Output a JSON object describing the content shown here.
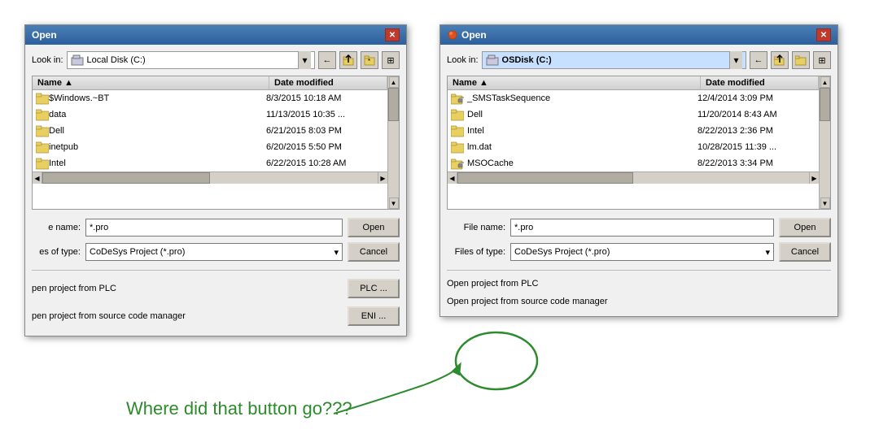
{
  "left_dialog": {
    "title": "Open",
    "look_in_label": "Look in:",
    "look_in_value": "Local Disk (C:)",
    "columns": [
      "Name",
      "Date modified"
    ],
    "files": [
      {
        "name": "$Windows.~BT",
        "date": "8/3/2015 10:18 AM",
        "type": "folder"
      },
      {
        "name": "data",
        "date": "11/13/2015 10:35 ...",
        "type": "folder"
      },
      {
        "name": "Dell",
        "date": "6/21/2015 8:03 PM",
        "type": "folder"
      },
      {
        "name": "inetpub",
        "date": "6/20/2015 5:50 PM",
        "type": "folder"
      },
      {
        "name": "Intel",
        "date": "6/22/2015 10:28 AM",
        "type": "folder"
      }
    ],
    "file_name_label": "e name:",
    "file_name_value": "*.pro",
    "file_type_label": "es of type:",
    "file_type_value": "CoDeSys Project (*.pro)",
    "open_btn": "Open",
    "cancel_btn": "Cancel",
    "plc_label": "pen project from PLC",
    "plc_btn": "PLC ...",
    "eni_label": "pen project from source code manager",
    "eni_btn": "ENI ..."
  },
  "right_dialog": {
    "title": "Open",
    "look_in_label": "Look in:",
    "look_in_value": "OSDisk (C:)",
    "columns": [
      "Name",
      "Date modified"
    ],
    "files": [
      {
        "name": "_SMSTaskSequence",
        "date": "12/4/2014 3:09 PM",
        "type": "folder-lock"
      },
      {
        "name": "Dell",
        "date": "11/20/2014 8:43 AM",
        "type": "folder"
      },
      {
        "name": "Intel",
        "date": "8/22/2013 2:36 PM",
        "type": "folder"
      },
      {
        "name": "lm.dat",
        "date": "10/28/2015 11:39 ...",
        "type": "folder"
      },
      {
        "name": "MSOCache",
        "date": "8/22/2013 3:34 PM",
        "type": "folder-lock"
      }
    ],
    "file_name_label": "File name:",
    "file_name_value": "*.pro",
    "file_type_label": "Files of type:",
    "file_type_value": "CoDeSys Project (*.pro)",
    "open_btn": "Open",
    "cancel_btn": "Cancel",
    "plc_label": "Open project from PLC",
    "eni_label": "Open project from source code manager"
  },
  "annotation": {
    "text": "Where did that button go???",
    "color": "#2d8a2d"
  }
}
